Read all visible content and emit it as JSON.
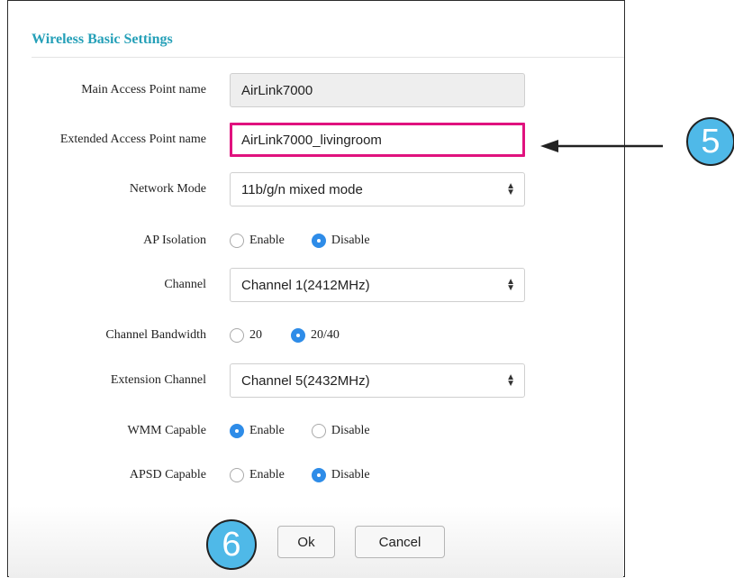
{
  "panel": {
    "title": "Wireless Basic Settings"
  },
  "fields": {
    "main_ap_name": {
      "label": "Main Access Point name",
      "value": "AirLink7000"
    },
    "extended_ap_name": {
      "label": "Extended Access Point name",
      "value": "AirLink7000_livingroom"
    },
    "network_mode": {
      "label": "Network Mode",
      "value": "11b/g/n mixed mode"
    },
    "ap_isolation": {
      "label": "AP Isolation",
      "options": [
        "Enable",
        "Disable"
      ],
      "selected": "Disable"
    },
    "channel": {
      "label": "Channel",
      "value": "Channel 1(2412MHz)"
    },
    "channel_bandwidth": {
      "label": "Channel Bandwidth",
      "options": [
        "20",
        "20/40"
      ],
      "selected": "20/40"
    },
    "extension_channel": {
      "label": "Extension Channel",
      "value": "Channel 5(2432MHz)"
    },
    "wmm_capable": {
      "label": "WMM Capable",
      "options": [
        "Enable",
        "Disable"
      ],
      "selected": "Enable"
    },
    "apsd_capable": {
      "label": "APSD Capable",
      "options": [
        "Enable",
        "Disable"
      ],
      "selected": "Disable"
    }
  },
  "buttons": {
    "ok": "Ok",
    "cancel": "Cancel"
  },
  "callouts": {
    "step5": "5",
    "step6": "6"
  },
  "colors": {
    "title": "#25a0b8",
    "highlight_border": "#e0127e",
    "radio_selected": "#2e8ce8",
    "callout_fill": "#4fb9e8"
  }
}
